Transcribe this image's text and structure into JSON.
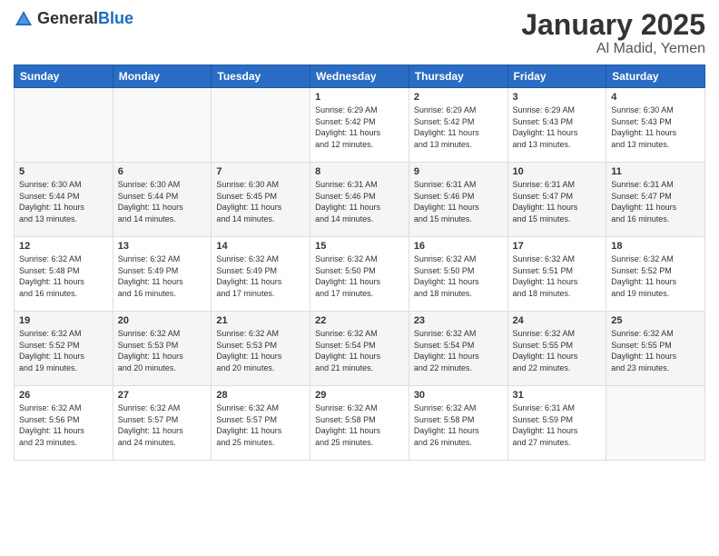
{
  "header": {
    "logo_general": "General",
    "logo_blue": "Blue",
    "month": "January 2025",
    "location": "Al Madid, Yemen"
  },
  "days_of_week": [
    "Sunday",
    "Monday",
    "Tuesday",
    "Wednesday",
    "Thursday",
    "Friday",
    "Saturday"
  ],
  "weeks": [
    [
      {
        "day": "",
        "info": ""
      },
      {
        "day": "",
        "info": ""
      },
      {
        "day": "",
        "info": ""
      },
      {
        "day": "1",
        "info": "Sunrise: 6:29 AM\nSunset: 5:42 PM\nDaylight: 11 hours\nand 12 minutes."
      },
      {
        "day": "2",
        "info": "Sunrise: 6:29 AM\nSunset: 5:42 PM\nDaylight: 11 hours\nand 13 minutes."
      },
      {
        "day": "3",
        "info": "Sunrise: 6:29 AM\nSunset: 5:43 PM\nDaylight: 11 hours\nand 13 minutes."
      },
      {
        "day": "4",
        "info": "Sunrise: 6:30 AM\nSunset: 5:43 PM\nDaylight: 11 hours\nand 13 minutes."
      }
    ],
    [
      {
        "day": "5",
        "info": "Sunrise: 6:30 AM\nSunset: 5:44 PM\nDaylight: 11 hours\nand 13 minutes."
      },
      {
        "day": "6",
        "info": "Sunrise: 6:30 AM\nSunset: 5:44 PM\nDaylight: 11 hours\nand 14 minutes."
      },
      {
        "day": "7",
        "info": "Sunrise: 6:30 AM\nSunset: 5:45 PM\nDaylight: 11 hours\nand 14 minutes."
      },
      {
        "day": "8",
        "info": "Sunrise: 6:31 AM\nSunset: 5:46 PM\nDaylight: 11 hours\nand 14 minutes."
      },
      {
        "day": "9",
        "info": "Sunrise: 6:31 AM\nSunset: 5:46 PM\nDaylight: 11 hours\nand 15 minutes."
      },
      {
        "day": "10",
        "info": "Sunrise: 6:31 AM\nSunset: 5:47 PM\nDaylight: 11 hours\nand 15 minutes."
      },
      {
        "day": "11",
        "info": "Sunrise: 6:31 AM\nSunset: 5:47 PM\nDaylight: 11 hours\nand 16 minutes."
      }
    ],
    [
      {
        "day": "12",
        "info": "Sunrise: 6:32 AM\nSunset: 5:48 PM\nDaylight: 11 hours\nand 16 minutes."
      },
      {
        "day": "13",
        "info": "Sunrise: 6:32 AM\nSunset: 5:49 PM\nDaylight: 11 hours\nand 16 minutes."
      },
      {
        "day": "14",
        "info": "Sunrise: 6:32 AM\nSunset: 5:49 PM\nDaylight: 11 hours\nand 17 minutes."
      },
      {
        "day": "15",
        "info": "Sunrise: 6:32 AM\nSunset: 5:50 PM\nDaylight: 11 hours\nand 17 minutes."
      },
      {
        "day": "16",
        "info": "Sunrise: 6:32 AM\nSunset: 5:50 PM\nDaylight: 11 hours\nand 18 minutes."
      },
      {
        "day": "17",
        "info": "Sunrise: 6:32 AM\nSunset: 5:51 PM\nDaylight: 11 hours\nand 18 minutes."
      },
      {
        "day": "18",
        "info": "Sunrise: 6:32 AM\nSunset: 5:52 PM\nDaylight: 11 hours\nand 19 minutes."
      }
    ],
    [
      {
        "day": "19",
        "info": "Sunrise: 6:32 AM\nSunset: 5:52 PM\nDaylight: 11 hours\nand 19 minutes."
      },
      {
        "day": "20",
        "info": "Sunrise: 6:32 AM\nSunset: 5:53 PM\nDaylight: 11 hours\nand 20 minutes."
      },
      {
        "day": "21",
        "info": "Sunrise: 6:32 AM\nSunset: 5:53 PM\nDaylight: 11 hours\nand 20 minutes."
      },
      {
        "day": "22",
        "info": "Sunrise: 6:32 AM\nSunset: 5:54 PM\nDaylight: 11 hours\nand 21 minutes."
      },
      {
        "day": "23",
        "info": "Sunrise: 6:32 AM\nSunset: 5:54 PM\nDaylight: 11 hours\nand 22 minutes."
      },
      {
        "day": "24",
        "info": "Sunrise: 6:32 AM\nSunset: 5:55 PM\nDaylight: 11 hours\nand 22 minutes."
      },
      {
        "day": "25",
        "info": "Sunrise: 6:32 AM\nSunset: 5:55 PM\nDaylight: 11 hours\nand 23 minutes."
      }
    ],
    [
      {
        "day": "26",
        "info": "Sunrise: 6:32 AM\nSunset: 5:56 PM\nDaylight: 11 hours\nand 23 minutes."
      },
      {
        "day": "27",
        "info": "Sunrise: 6:32 AM\nSunset: 5:57 PM\nDaylight: 11 hours\nand 24 minutes."
      },
      {
        "day": "28",
        "info": "Sunrise: 6:32 AM\nSunset: 5:57 PM\nDaylight: 11 hours\nand 25 minutes."
      },
      {
        "day": "29",
        "info": "Sunrise: 6:32 AM\nSunset: 5:58 PM\nDaylight: 11 hours\nand 25 minutes."
      },
      {
        "day": "30",
        "info": "Sunrise: 6:32 AM\nSunset: 5:58 PM\nDaylight: 11 hours\nand 26 minutes."
      },
      {
        "day": "31",
        "info": "Sunrise: 6:31 AM\nSunset: 5:59 PM\nDaylight: 11 hours\nand 27 minutes."
      },
      {
        "day": "",
        "info": ""
      }
    ]
  ]
}
